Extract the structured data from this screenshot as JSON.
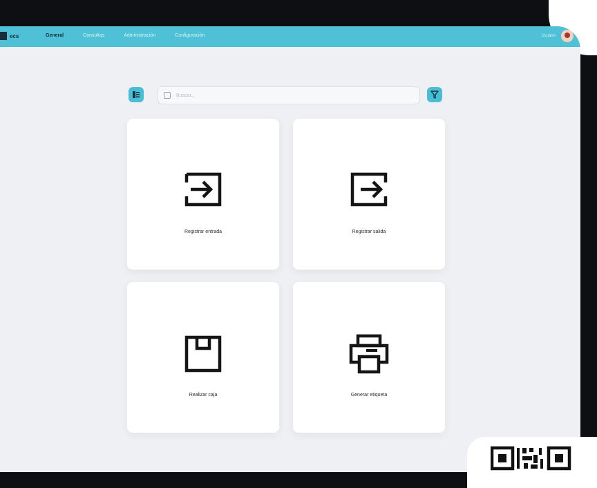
{
  "app": {
    "name": "ecs"
  },
  "nav": {
    "items": [
      "General",
      "Consultas",
      "Administración",
      "Configuración"
    ],
    "active_index": 0
  },
  "user": {
    "name": "Usuario"
  },
  "search": {
    "placeholder": "Buscar..."
  },
  "cards": [
    {
      "label": "Registrar entrada",
      "icon": "enter-icon"
    },
    {
      "label": "Registrar salida",
      "icon": "exit-icon"
    },
    {
      "label": "Realizar caja",
      "icon": "box-icon"
    },
    {
      "label": "Generar etiqueta",
      "icon": "printer-icon"
    }
  ],
  "colors": {
    "accent": "#4ec1d6",
    "button": "#48bed5",
    "background": "#eef0f3",
    "bezel": "#0d0f12"
  }
}
